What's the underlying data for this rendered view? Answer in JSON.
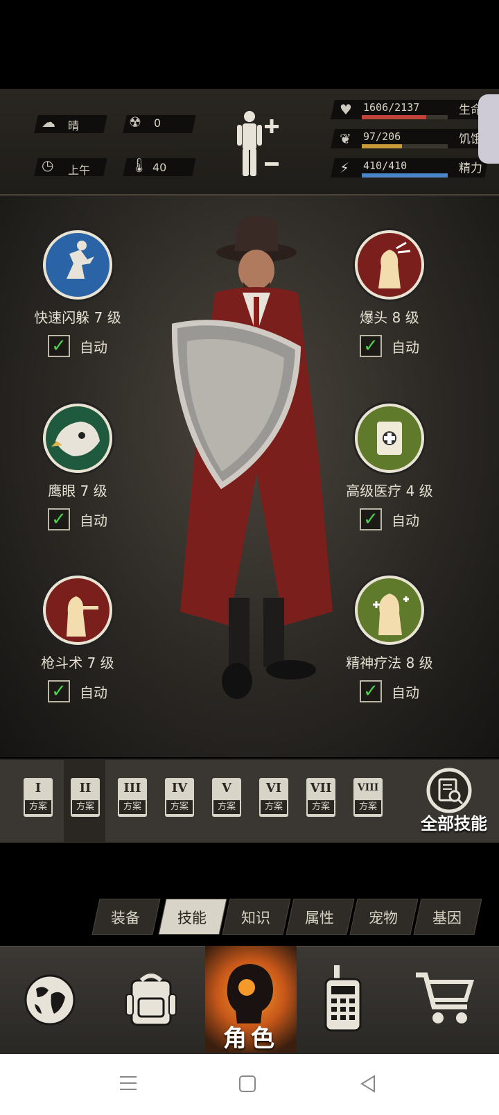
{
  "status": {
    "weather": "晴",
    "radiation": "0",
    "time_of_day": "上午",
    "temperature": "40",
    "stats": [
      {
        "value": "1606/2137",
        "label": "生命",
        "fill": 0.751,
        "color": "#c0443a"
      },
      {
        "value": "97/206",
        "label": "饥饿",
        "fill": 0.471,
        "color": "#c79a3a"
      },
      {
        "value": "410/410",
        "label": "精力",
        "fill": 1.0,
        "color": "#4a86c7"
      }
    ]
  },
  "skills": [
    {
      "name": "快速闪躲 7 级",
      "auto": "自动",
      "checked": true,
      "color": "#2b64a6",
      "icon": "dodge-icon"
    },
    {
      "name": "爆头 8 级",
      "auto": "自动",
      "checked": true,
      "color": "#7a1f1c",
      "icon": "headshot-icon"
    },
    {
      "name": "鹰眼 7 级",
      "auto": "自动",
      "checked": true,
      "color": "#1f5a3e",
      "icon": "eagle-eye-icon"
    },
    {
      "name": "高级医疗 4 级",
      "auto": "自动",
      "checked": true,
      "color": "#5f7a2a",
      "icon": "medical-kit-icon"
    },
    {
      "name": "枪斗术 7 级",
      "auto": "自动",
      "checked": true,
      "color": "#7a1f1c",
      "icon": "gunfighter-icon"
    },
    {
      "name": "精神疗法 8 级",
      "auto": "自动",
      "checked": true,
      "color": "#5f7a2a",
      "icon": "mental-therapy-icon"
    }
  ],
  "plans": [
    {
      "num": "I",
      "label": "方案"
    },
    {
      "num": "II",
      "label": "方案"
    },
    {
      "num": "III",
      "label": "方案"
    },
    {
      "num": "IV",
      "label": "方案"
    },
    {
      "num": "V",
      "label": "方案"
    },
    {
      "num": "VI",
      "label": "方案"
    },
    {
      "num": "VII",
      "label": "方案"
    },
    {
      "num": "VIII",
      "label": "方案"
    }
  ],
  "selected_plan": 2,
  "all_skills_label": "全部技能",
  "tabs": [
    "装备",
    "技能",
    "知识",
    "属性",
    "宠物",
    "基因"
  ],
  "active_tab": "技能",
  "nav": {
    "role_label": "角色",
    "items": [
      "globe-icon",
      "backpack-icon",
      "role-icon",
      "radio-icon",
      "cart-icon"
    ]
  }
}
